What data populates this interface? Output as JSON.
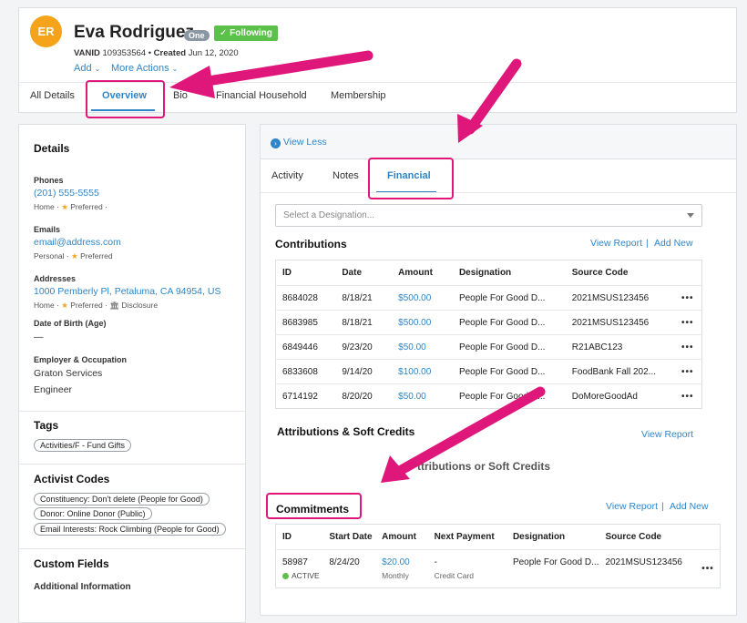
{
  "profile": {
    "initials": "ER",
    "name": "Eva Rodriguez",
    "tier_badge": "One",
    "following_label": "Following",
    "vanid_label": "VANID",
    "vanid": "109353564",
    "created_label": "Created",
    "created": "Jun 12, 2020",
    "add_label": "Add",
    "more_actions_label": "More Actions"
  },
  "top_tabs": [
    "All Details",
    "Overview",
    "Bio",
    "Financial Household",
    "Membership"
  ],
  "details": {
    "title": "Details",
    "phones_label": "Phones",
    "phone": "(201) 555-5555",
    "phone_meta_a": "Home ·",
    "phone_meta_b": "Preferred ·",
    "emails_label": "Emails",
    "email": "email@address.com",
    "email_meta_a": "Personal ·",
    "email_meta_b": "Preferred",
    "addresses_label": "Addresses",
    "address": "1000 Pemberly Pl, Petaluma, CA 94954, US",
    "address_meta_a": "Home ·",
    "address_meta_b": "Preferred ·",
    "address_meta_c": "Disclosure",
    "dob_label": "Date of Birth (Age)",
    "dob": "—",
    "employer_label": "Employer & Occupation",
    "employer": "Graton Services",
    "occupation": "Engineer"
  },
  "tags": {
    "title": "Tags",
    "items": [
      "Activities/F - Fund Gifts"
    ]
  },
  "activist_codes": {
    "title": "Activist Codes",
    "items": [
      "Constituency: Don't delete (People for Good)",
      "Donor: Online Donor (Public)",
      "Email Interests: Rock Climbing (People for Good)"
    ]
  },
  "custom_fields": {
    "title": "Custom Fields",
    "subtitle": "Additional Information"
  },
  "right_panel": {
    "view_less": "View Less",
    "tabs": [
      "Activity",
      "Notes",
      "Financial"
    ],
    "designation_placeholder": "Select a Designation..."
  },
  "contributions": {
    "title": "Contributions",
    "view_report": "View Report",
    "separator": "|",
    "add_new": "Add New",
    "columns": [
      "ID",
      "Date",
      "Amount",
      "Designation",
      "Source Code"
    ],
    "rows": [
      [
        "8684028",
        "8/18/21",
        "$500.00",
        "People For Good D...",
        "2021MSUS123456"
      ],
      [
        "8683985",
        "8/18/21",
        "$500.00",
        "People For Good D...",
        "2021MSUS123456"
      ],
      [
        "6849446",
        "9/23/20",
        "$50.00",
        "People For Good D...",
        "R21ABC123"
      ],
      [
        "6833608",
        "9/14/20",
        "$100.00",
        "People For Good D...",
        "FoodBank Fall 202..."
      ],
      [
        "6714192",
        "8/20/20",
        "$50.00",
        "People For Good D...",
        "DoMoreGoodAd"
      ]
    ],
    "more": "•••"
  },
  "attributions": {
    "title": "Attributions & Soft Credits",
    "view_report": "View Report",
    "empty_text": "ttributions or Soft Credits"
  },
  "commitments": {
    "title": "Commitments",
    "view_report": "View Report",
    "separator": "|",
    "add_new": "Add New",
    "columns": [
      "ID",
      "Start Date",
      "Amount",
      "Next Payment",
      "Designation",
      "Source Code"
    ],
    "row": {
      "id": "58987",
      "status": "ACTIVE",
      "start": "8/24/20",
      "amount": "$20.00",
      "frequency": "Monthly",
      "next_payment": "-",
      "method": "Credit Card",
      "designation": "People For Good D...",
      "source": "2021MSUS123456"
    },
    "more": "•••"
  },
  "colors": {
    "accent": "#2e86c8",
    "highlight": "#e0177a",
    "following": "#5cc14a",
    "avatar": "#f5a31a"
  }
}
